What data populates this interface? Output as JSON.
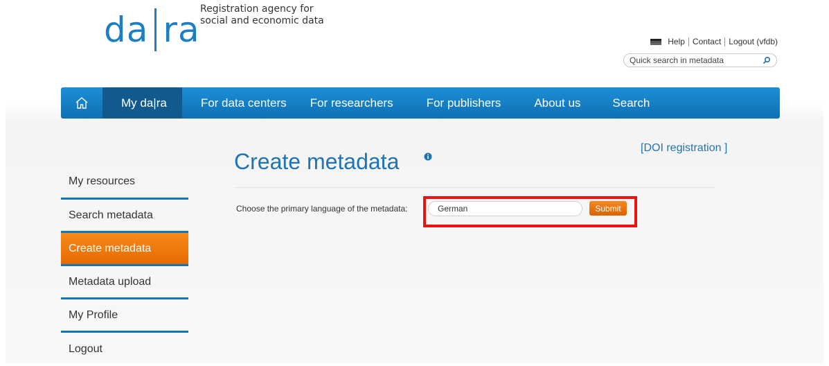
{
  "logo": {
    "left": "da",
    "right": "ra"
  },
  "tagline": {
    "line1": "Registration agency for",
    "line2": "social and economic data"
  },
  "toplinks": {
    "help": "Help",
    "contact": "Contact",
    "logout": "Logout (vfdb)"
  },
  "search": {
    "placeholder": "Quick search in metadata"
  },
  "nav": {
    "items": [
      "My da|ra",
      "For data centers",
      "For researchers",
      "For publishers",
      "About us",
      "Search"
    ],
    "active": "My da|ra"
  },
  "sidebar": {
    "items": [
      "My resources",
      "Search metadata",
      "Create metadata",
      "Metadata upload",
      "My Profile",
      "Logout"
    ],
    "active": "Create metadata"
  },
  "main": {
    "title": "Create metadata",
    "doi_link": "[DOI registration ]",
    "language_label": "Choose the primary language of the metadata:",
    "language_value": "German",
    "submit_label": "Submit"
  },
  "colors": {
    "brand_blue": "#1d7fc2",
    "accent_orange": "#f07b12",
    "highlight_red": "#ee1111"
  }
}
